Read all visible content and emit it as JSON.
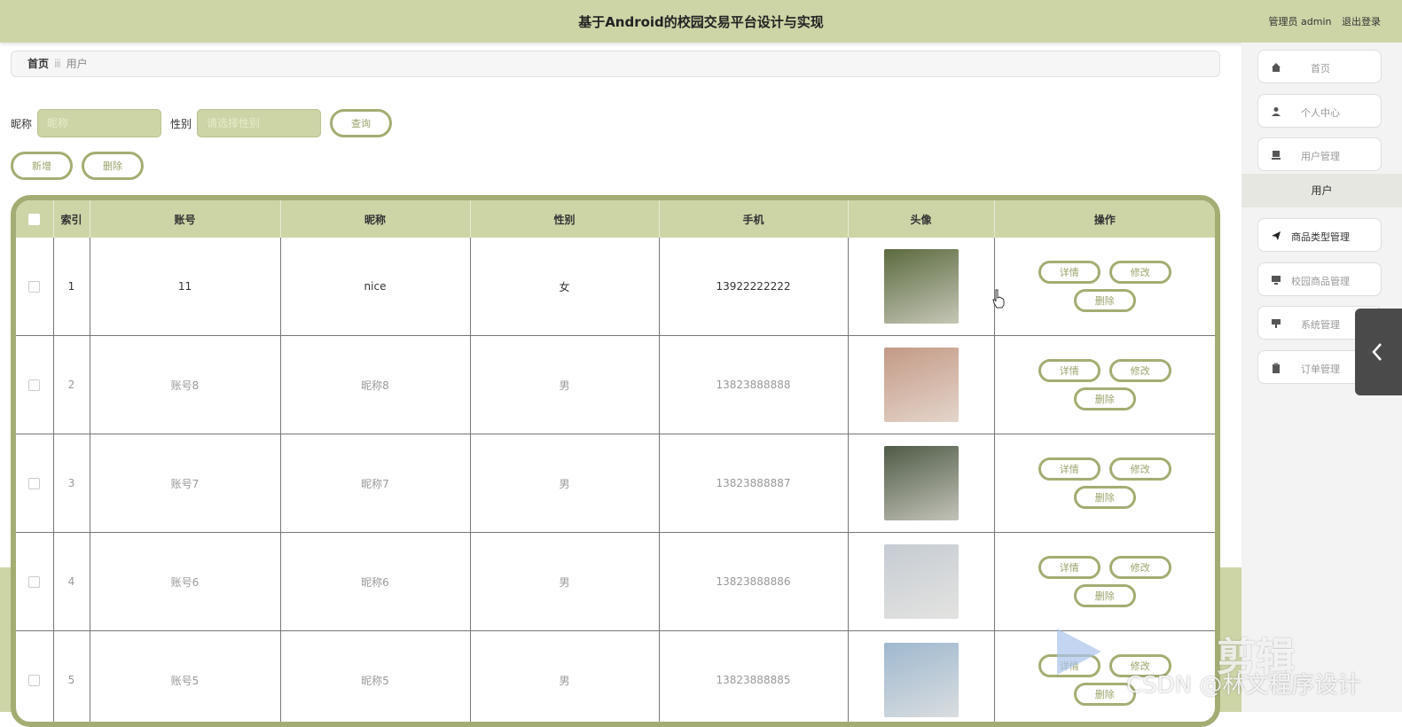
{
  "header": {
    "title": "基于Android的校园交易平台设计与实现",
    "user_text": "管理员 admin",
    "logout_label": "退出登录"
  },
  "breadcrumb": {
    "home": "首页",
    "current": "用户"
  },
  "search": {
    "nickname_label": "昵称",
    "nickname_placeholder": "昵称",
    "gender_label": "性别",
    "gender_placeholder": "请选择性别",
    "query_label": "查询"
  },
  "actions": {
    "add_label": "新增",
    "delete_label": "删除"
  },
  "table": {
    "headers": [
      "索引",
      "账号",
      "昵称",
      "性别",
      "手机",
      "头像",
      "操作"
    ],
    "rows": [
      {
        "index": "1",
        "account": "11",
        "nickname": "nice",
        "gender": "女",
        "phone": "13922222222",
        "avatar_color": "#5b6a3f"
      },
      {
        "index": "2",
        "account": "账号8",
        "nickname": "昵称8",
        "gender": "男",
        "phone": "13823888888",
        "avatar_color": "#c49a86"
      },
      {
        "index": "3",
        "account": "账号7",
        "nickname": "昵称7",
        "gender": "男",
        "phone": "13823888887",
        "avatar_color": "#4f5b46"
      },
      {
        "index": "4",
        "account": "账号6",
        "nickname": "昵称6",
        "gender": "男",
        "phone": "13823888886",
        "avatar_color": "#c5ccd3"
      },
      {
        "index": "5",
        "account": "账号5",
        "nickname": "昵称5",
        "gender": "男",
        "phone": "13823888885",
        "avatar_color": "#9fb8cf"
      }
    ],
    "op_labels": {
      "detail": "详情",
      "edit": "修改",
      "delete": "删除"
    }
  },
  "sidebar": {
    "items": [
      {
        "label": "首页",
        "icon": "home-icon"
      },
      {
        "label": "个人中心",
        "icon": "person-icon"
      },
      {
        "label": "用户管理",
        "icon": "users-icon"
      },
      {
        "label": "商品类型管理",
        "icon": "send-icon"
      },
      {
        "label": "校园商品管理",
        "icon": "monitor-icon"
      },
      {
        "label": "系统管理",
        "icon": "settings-icon"
      },
      {
        "label": "订单管理",
        "icon": "clipboard-icon"
      }
    ],
    "sub_item": "用户"
  },
  "watermark": {
    "brand": "剪辑",
    "text": "CSDN @林文程序设计"
  },
  "colors": {
    "accent": "#cdd5a7",
    "border": "#a3ad73",
    "sidebar_bg": "#f3f3f3"
  }
}
